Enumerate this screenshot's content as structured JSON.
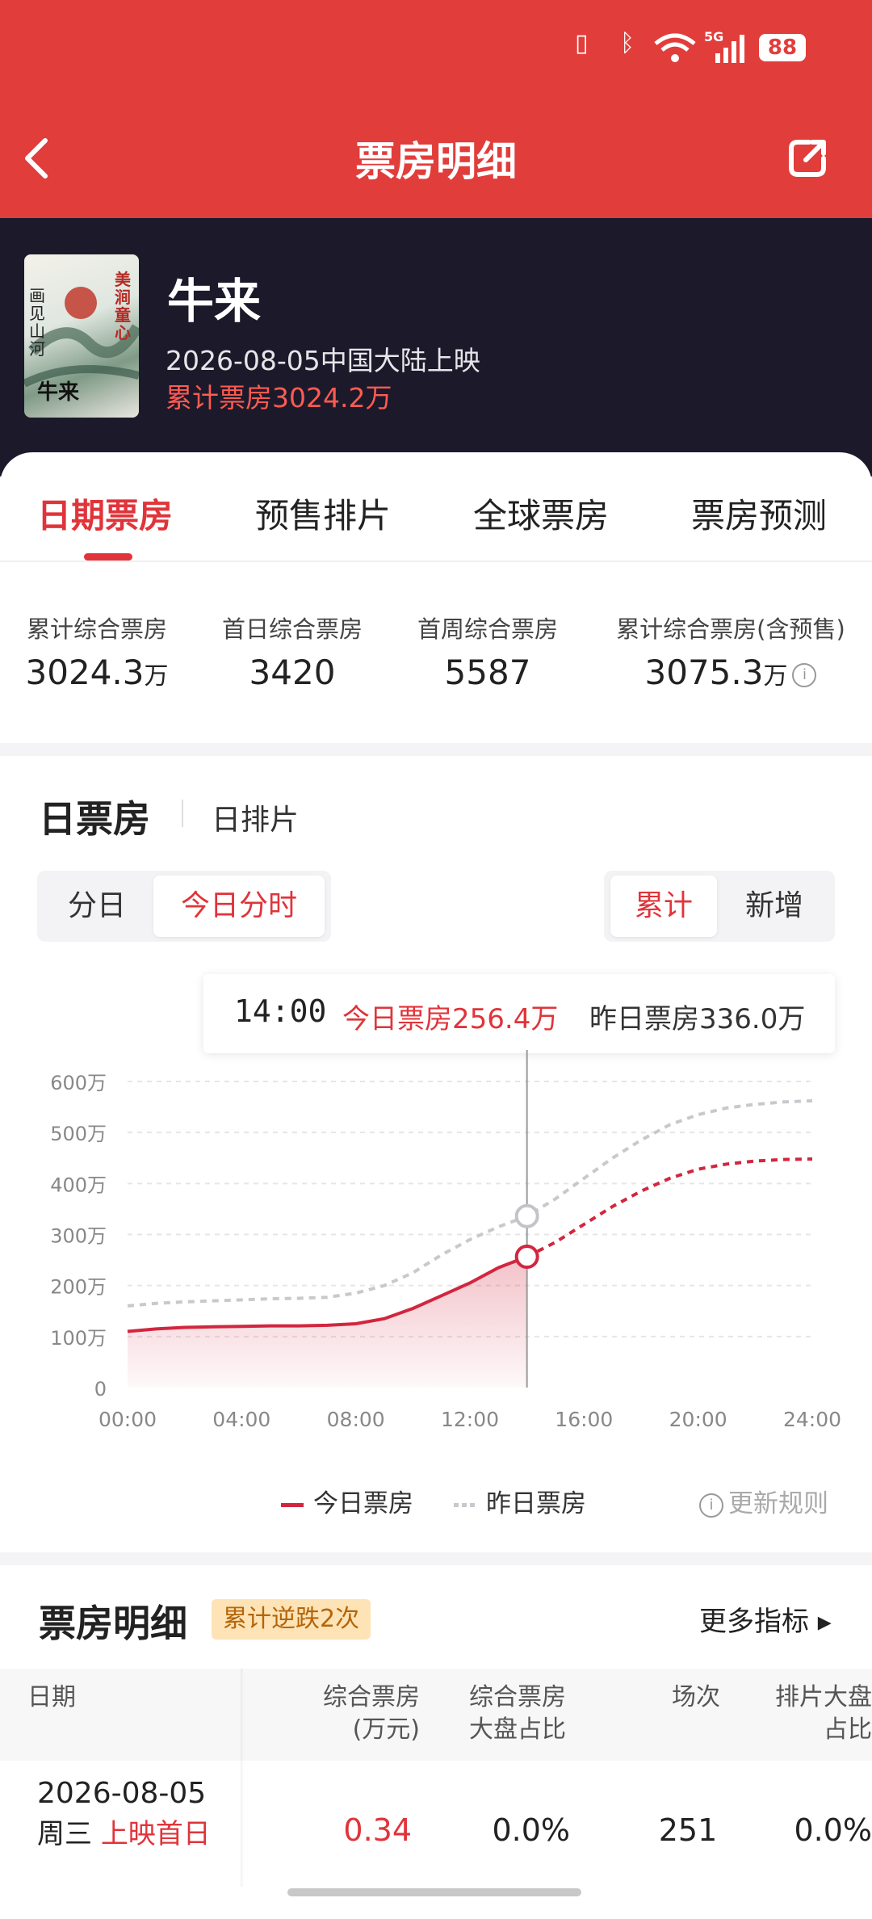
{
  "status_bar": {
    "battery": "88",
    "network": "5G"
  },
  "nav": {
    "title": "票房明细"
  },
  "movie": {
    "title": "牛来",
    "release": "2026-08-05中国大陆上映",
    "total": "累计票房3024.2万",
    "poster_text_1": "美涧童心",
    "poster_text_2": "画见山河",
    "poster_text_3": "牛来"
  },
  "tabs": [
    "日期票房",
    "预售排片",
    "全球票房",
    "票房预测"
  ],
  "stats": [
    {
      "label": "累计综合票房",
      "value": "3024.3",
      "unit": "万"
    },
    {
      "label": "首日综合票房",
      "value": "3420",
      "unit": ""
    },
    {
      "label": "首周综合票房",
      "value": "5587",
      "unit": ""
    },
    {
      "label": "累计综合票房(含预售)",
      "value": "3075.3",
      "unit": "万"
    }
  ],
  "daily": {
    "title": "日票房",
    "sub": "日排片",
    "seg_left": [
      "分日",
      "今日分时"
    ],
    "seg_right": [
      "累计",
      "新增"
    ]
  },
  "tooltip": {
    "time": "14:00",
    "today": "今日票房256.4万",
    "yesterday": "昨日票房336.0万"
  },
  "chart_data": {
    "type": "line",
    "x_ticks": [
      "00:00",
      "04:00",
      "08:00",
      "12:00",
      "16:00",
      "20:00",
      "24:00"
    ],
    "y_ticks": [
      "600万",
      "500万",
      "400万",
      "300万",
      "200万",
      "100万",
      "0"
    ],
    "ylim": [
      0,
      600
    ],
    "xlim": [
      0,
      24
    ],
    "cursor_x": 14,
    "series": [
      {
        "name": "今日票房",
        "color": "#d2263f",
        "x": [
          0,
          1,
          2,
          3,
          4,
          5,
          6,
          7,
          8,
          9,
          10,
          11,
          12,
          13,
          14
        ],
        "y": [
          110,
          115,
          118,
          119,
          120,
          121,
          121,
          122,
          125,
          135,
          155,
          180,
          205,
          235,
          256.4
        ],
        "forecast_x": [
          14,
          15,
          16,
          17,
          18,
          19,
          20,
          21,
          22,
          23,
          24
        ],
        "forecast_y": [
          256.4,
          285,
          320,
          355,
          385,
          410,
          428,
          438,
          444,
          447,
          448
        ]
      },
      {
        "name": "昨日票房",
        "color": "#c9c9cd",
        "x": [
          0,
          1,
          2,
          3,
          4,
          5,
          6,
          7,
          8,
          9,
          10,
          11,
          12,
          13,
          14,
          15,
          16,
          17,
          18,
          19,
          20,
          21,
          22,
          23,
          24
        ],
        "y": [
          160,
          165,
          168,
          170,
          172,
          174,
          175,
          177,
          185,
          200,
          225,
          260,
          290,
          315,
          336,
          370,
          410,
          450,
          485,
          515,
          535,
          548,
          555,
          560,
          562
        ]
      }
    ]
  },
  "legend": {
    "today": "今日票房",
    "yesterday": "昨日票房",
    "rule": "更新规则"
  },
  "detail": {
    "title": "票房明细",
    "badge": "累计逆跌2次",
    "more": "更多指标 ▸",
    "headers": [
      {
        "l1": "日期",
        "l2": ""
      },
      {
        "l1": "综合票房",
        "l2": "(万元)"
      },
      {
        "l1": "综合票房",
        "l2": "大盘占比"
      },
      {
        "l1": "场次",
        "l2": ""
      },
      {
        "l1": "排片大盘",
        "l2": "占比"
      }
    ],
    "row": {
      "date": "2026-08-05",
      "weekday": "周三",
      "tag": "上映首日",
      "gross": "0.34",
      "share": "0.0%",
      "shows": "251",
      "sched": "0.0%"
    }
  }
}
